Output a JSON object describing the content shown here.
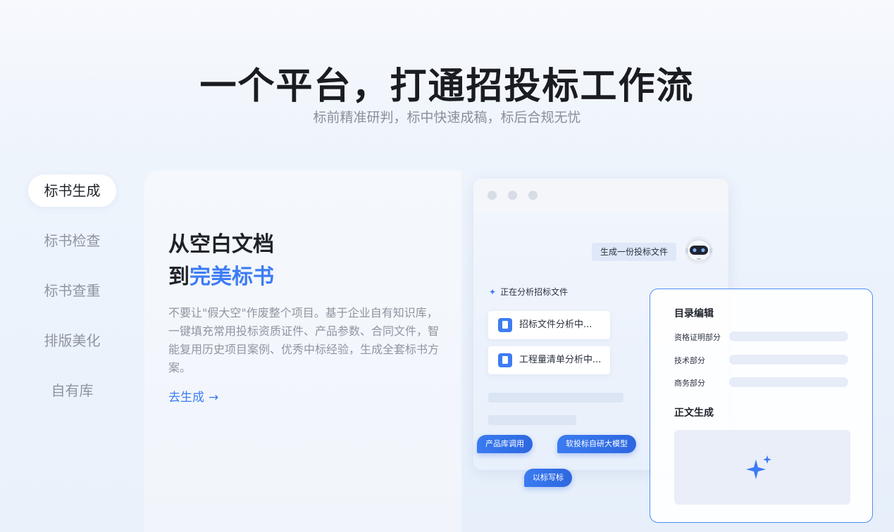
{
  "hero": {
    "title": "一个平台，打通招投标工作流",
    "subtitle": "标前精准研判，标中快速成稿，标后合规无忧"
  },
  "nav": {
    "items": [
      {
        "label": "标书生成",
        "active": true
      },
      {
        "label": "标书检查",
        "active": false
      },
      {
        "label": "标书查重",
        "active": false
      },
      {
        "label": "排版美化",
        "active": false
      },
      {
        "label": "自有库",
        "active": false
      }
    ]
  },
  "feature": {
    "heading_line1": "从空白文档",
    "heading_line2_prefix": "到",
    "heading_line2_highlight": "完美标书",
    "description": "不要让\"假大空\"作废整个项目。基于企业自有知识库，一键填充常用投标资质证件、产品参数、合同文件，智能复用历史项目案例、优秀中标经验，生成全套标书方案。",
    "cta_label": "去生成",
    "cta_arrow": "→",
    "accent_color": "#3d7cf4"
  },
  "mockup": {
    "chat_message": "生成一份投标文件",
    "analyzing_text": "正在分析招标文件",
    "files": [
      {
        "label": "招标文件分析中..."
      },
      {
        "label": "工程量清单分析中..."
      }
    ],
    "tags": {
      "product_lib": "产品库调用",
      "model": "软投标自研大模型",
      "reference": "以标写标"
    }
  },
  "directory": {
    "title": "目录编辑",
    "rows": [
      {
        "label": "资格证明部分"
      },
      {
        "label": "技术部分"
      },
      {
        "label": "商务部分"
      }
    ],
    "generate_title": "正文生成"
  }
}
